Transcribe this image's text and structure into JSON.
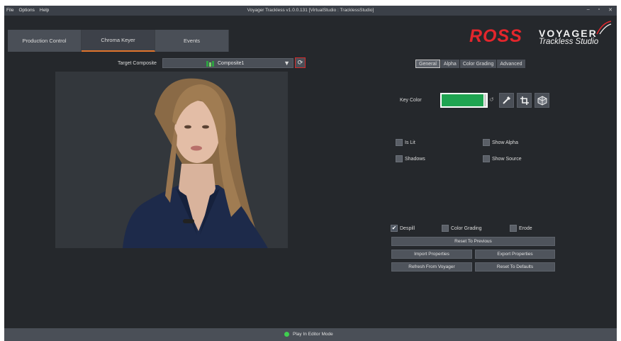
{
  "window": {
    "title": "Voyager Trackless v1.0.0.131 [VirtualStudio : TracklessStudio]",
    "menu": [
      "File",
      "Options",
      "Help"
    ],
    "controls": [
      "–",
      "▫",
      "✕"
    ]
  },
  "tabs": [
    {
      "label": "Production Control",
      "active": false
    },
    {
      "label": "Chroma Keyer",
      "active": true
    },
    {
      "label": "Events",
      "active": false
    }
  ],
  "logo": {
    "brand": "ROSS",
    "product": "VOYAGER",
    "subtitle": "Trackless Studio"
  },
  "target_composite": {
    "label": "Target Composite",
    "value": "Composite1",
    "icon": "composite-icon"
  },
  "sub_tabs": [
    {
      "label": "General",
      "active": true
    },
    {
      "label": "Alpha",
      "active": false
    },
    {
      "label": "Color Grading",
      "active": false
    },
    {
      "label": "Advanced",
      "active": false
    }
  ],
  "key_color": {
    "label": "Key Color",
    "value": "#1fa451",
    "tools": [
      "eyedropper-icon",
      "crop-icon",
      "cube-icon"
    ]
  },
  "options": {
    "is_lit": {
      "label": "Is Lit",
      "checked": false
    },
    "show_alpha": {
      "label": "Show Alpha",
      "checked": false
    },
    "shadows": {
      "label": "Shadows",
      "checked": false
    },
    "show_source": {
      "label": "Show Source",
      "checked": false
    },
    "despill": {
      "label": "Despill",
      "checked": true
    },
    "color_grading": {
      "label": "Color Grading",
      "checked": false
    },
    "erode": {
      "label": "Erode",
      "checked": false
    }
  },
  "buttons": {
    "reset_previous": "Reset To Previous",
    "import": "Import Properties",
    "export": "Export Properties",
    "refresh": "Refresh From Voyager",
    "reset_defaults": "Reset To Defaults"
  },
  "status": {
    "text": "Play In Editor Mode",
    "color": "#3fcf4f"
  }
}
